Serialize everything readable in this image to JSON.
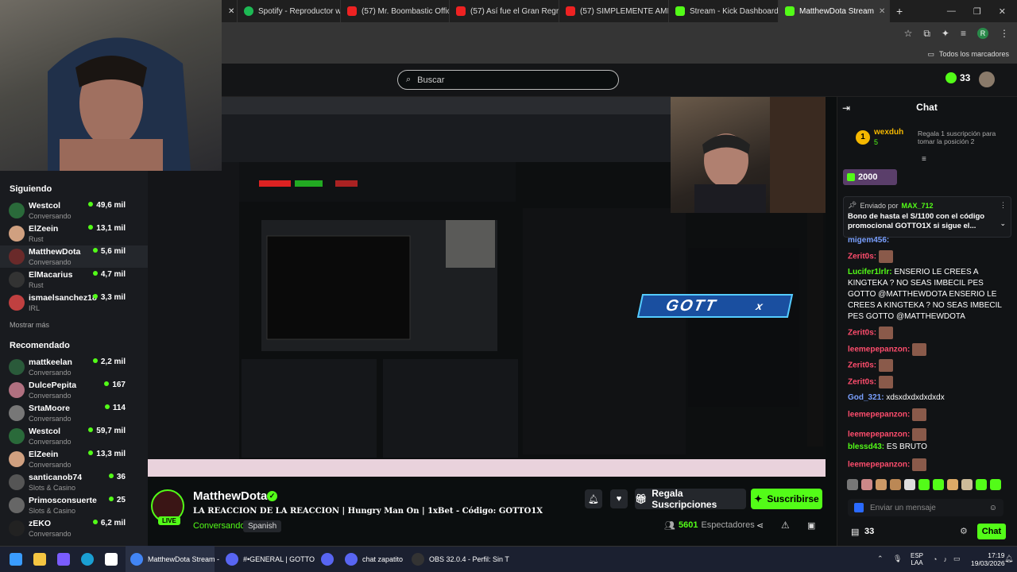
{
  "browser": {
    "tabs": [
      {
        "label": "Spotify - Reproductor we",
        "color": "#1db954"
      },
      {
        "label": "(57) Mr. Boombastic Offic",
        "color": "#e22"
      },
      {
        "label": "(57) Así fue el Gran Regre",
        "color": "#e22"
      },
      {
        "label": "(57) SIMPLEMENTE AMIG",
        "color": "#e22"
      },
      {
        "label": "Stream - Kick Dashboard",
        "color": "#53fc18"
      },
      {
        "label": "MatthewDota Stream",
        "color": "#53fc18"
      }
    ],
    "bookmarks_label": "Todos los marcadores",
    "profile_initial": "R"
  },
  "header": {
    "search_placeholder": "Buscar",
    "coins": "33"
  },
  "sidebar": {
    "following_title": "Siguiendo",
    "following": [
      {
        "name": "Westcol",
        "category": "Conversando",
        "viewers": "49,6 mil",
        "color": "#2a6a3a"
      },
      {
        "name": "ElZeein",
        "category": "Rust",
        "viewers": "13,1 mil",
        "color": "#d0a080"
      },
      {
        "name": "MatthewDota",
        "category": "Conversando",
        "viewers": "5,6 mil",
        "color": "#6a2a2a"
      },
      {
        "name": "ElMacarius",
        "category": "Rust",
        "viewers": "4,7 mil",
        "color": "#333"
      },
      {
        "name": "ismaelsanchez18",
        "category": "IRL",
        "viewers": "3,3 mil",
        "color": "#c04040"
      }
    ],
    "show_more": "Mostrar más",
    "recommended_title": "Recomendado",
    "recommended": [
      {
        "name": "mattkeelan",
        "category": "Conversando",
        "viewers": "2,2 mil",
        "color": "#2a5a3a"
      },
      {
        "name": "DulcePepita",
        "category": "Conversando",
        "viewers": "167",
        "color": "#b07080"
      },
      {
        "name": "SrtaMoore",
        "category": "Conversando",
        "viewers": "114",
        "color": "#777"
      },
      {
        "name": "Westcol",
        "category": "Conversando",
        "viewers": "59,7 mil",
        "color": "#2a6a3a"
      },
      {
        "name": "ElZeein",
        "category": "Conversando",
        "viewers": "13,3 mil",
        "color": "#d0a080"
      },
      {
        "name": "santicanob74",
        "category": "Slots & Casino",
        "viewers": "36",
        "color": "#555"
      },
      {
        "name": "Primosconsuerte",
        "category": "Slots & Casino",
        "viewers": "25",
        "color": "#666"
      },
      {
        "name": "zEKO",
        "category": "Conversando",
        "viewers": "6,2 mil",
        "color": "#222"
      }
    ]
  },
  "stream_overlay": {
    "banner": "GOTT",
    "banner_suffix": "x"
  },
  "channel": {
    "name": "MatthewDota",
    "live_badge": "LIVE",
    "title": "LA REACCION DE LA REACCION | Hungry Man On | 1xBet - Código: GOTTO1X",
    "category": "Conversando",
    "language": "Spanish",
    "gift_label": "Regala Suscripciones",
    "subscribe_label": "Suscribirse",
    "viewers_count": "5601",
    "viewers_label": "Espectadores"
  },
  "chat": {
    "title": "Chat",
    "top_gifter": "wexduh",
    "top_gifter_count": "5",
    "top_gift_hint": "Regala 1 suscripción para tomar la posición 2",
    "kicks": "2000",
    "pinned_from_label": "Enviado por",
    "pinned_user": "MAX_712",
    "pinned_text": "Bono de hasta el S/1100 con el código promocional GOTTO1X si sigue el...",
    "messages": [
      {
        "user": "migem456:",
        "color": "#7aa0ff",
        "text": "",
        "emote": false
      },
      {
        "user": "Zerit0s:",
        "color": "#ff4d6d",
        "text": "",
        "emote": true
      },
      {
        "user": "Lucifer1lrlr:",
        "color": "#53fc18",
        "text": "ENSERIO LE CREES A KINGTEKA ? NO SEAS IMBECIL PES GOTTO @MATTHEWDOTA ENSERIO LE CREES A KINGTEKA ? NO SEAS IMBECIL PES GOTTO @MATTHEWDOTA",
        "emote": false
      },
      {
        "user": "Zerit0s:",
        "color": "#ff4d6d",
        "text": "",
        "emote": true
      },
      {
        "user": "leemepepanzon:",
        "color": "#ff4d6d",
        "text": "",
        "emote": true
      },
      {
        "user": "Zerit0s:",
        "color": "#ff4d6d",
        "text": "",
        "emote": true
      },
      {
        "user": "Zerit0s:",
        "color": "#ff4d6d",
        "text": "",
        "emote": true
      },
      {
        "user": "God_321:",
        "color": "#7aa0ff",
        "text": "xdsxdxdxdxdxdx",
        "emote": false
      },
      {
        "user": "leemepepanzon:",
        "color": "#ff4d6d",
        "text": "",
        "emote": true
      },
      {
        "user": "leemepepanzon:",
        "color": "#ff4d6d",
        "text": "",
        "emote": true
      },
      {
        "user": "blessd43:",
        "color": "#53fc18",
        "text": "ES BRUTO",
        "emote": false
      },
      {
        "user": "leemepepanzon:",
        "color": "#ff4d6d",
        "text": "",
        "emote": true
      }
    ],
    "input_placeholder": "Enviar un mensaje",
    "points": "33",
    "send_label": "Chat"
  },
  "taskbar": {
    "items": [
      {
        "label": "MatthewDota Stream -",
        "color": "#4285f4"
      },
      {
        "label": "#•GENERAL | GOTTO",
        "color": "#5865f2"
      },
      {
        "label": "",
        "color": "#5865f2"
      },
      {
        "label": "chat zapatito",
        "color": "#5865f2"
      },
      {
        "label": "OBS 32.0.4 - Perfil: Sin T",
        "color": "#333"
      }
    ],
    "lang": "ESP",
    "lang2": "LAA",
    "time": "17:19",
    "date": "19/03/2026"
  }
}
